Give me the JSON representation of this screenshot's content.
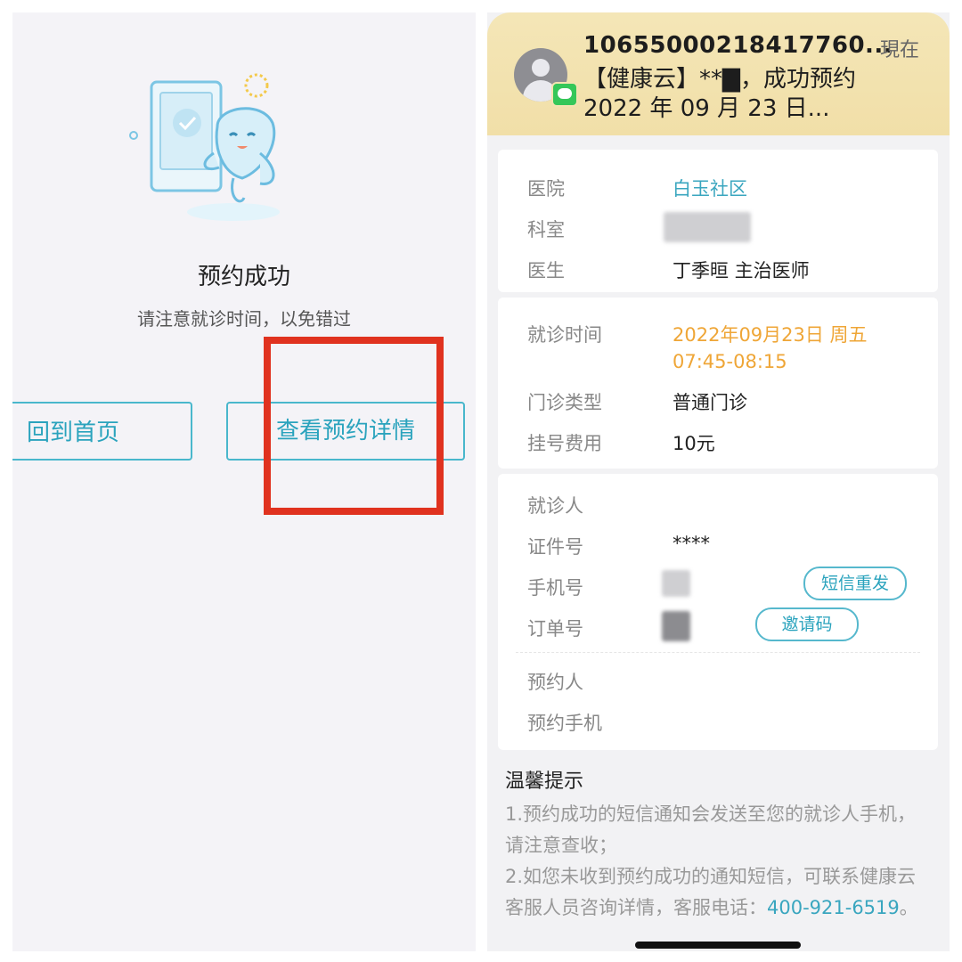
{
  "left": {
    "title": "预约成功",
    "subtitle": "请注意就诊时间，以免错过",
    "home_button": "回到首页",
    "detail_button": "查看预约详情",
    "highlight_color": "#e0321f",
    "accent_color": "#2aa3bd"
  },
  "notification": {
    "sender": "10655000218417760...",
    "time": "現在",
    "line1": "【健康云】**▇，成功预约",
    "line2": "2022 年 09 月 23 日..."
  },
  "appointment": {
    "hospital_label": "医院",
    "hospital_value": "白玉社区",
    "department_label": "科室",
    "doctor_label": "医生",
    "doctor_value": "丁季晅 主治医师",
    "visit_time_label": "就诊时间",
    "visit_date": "2022年09月23日 周五",
    "visit_slot": "07:45-08:15",
    "clinic_type_label": "门诊类型",
    "clinic_type_value": "普通门诊",
    "fee_label": "挂号费用",
    "fee_value": "10元"
  },
  "patient": {
    "patient_label": "就诊人",
    "id_label": "证件号",
    "id_value": "****",
    "phone_label": "手机号",
    "resend_sms_button": "短信重发",
    "order_label": "订单号",
    "invite_code_button": "邀请码",
    "booker_label": "预约人",
    "booker_phone_label": "预约手机"
  },
  "tips": {
    "title": "温馨提示",
    "line1": "1.预约成功的短信通知会发送至您的就诊人手机，请注意查收；",
    "line2": "2.如您未收到预约成功的通知短信，可联系健康云客服人员咨询详情，客服电话：",
    "phone": "400-921-6519",
    "end": "。"
  }
}
